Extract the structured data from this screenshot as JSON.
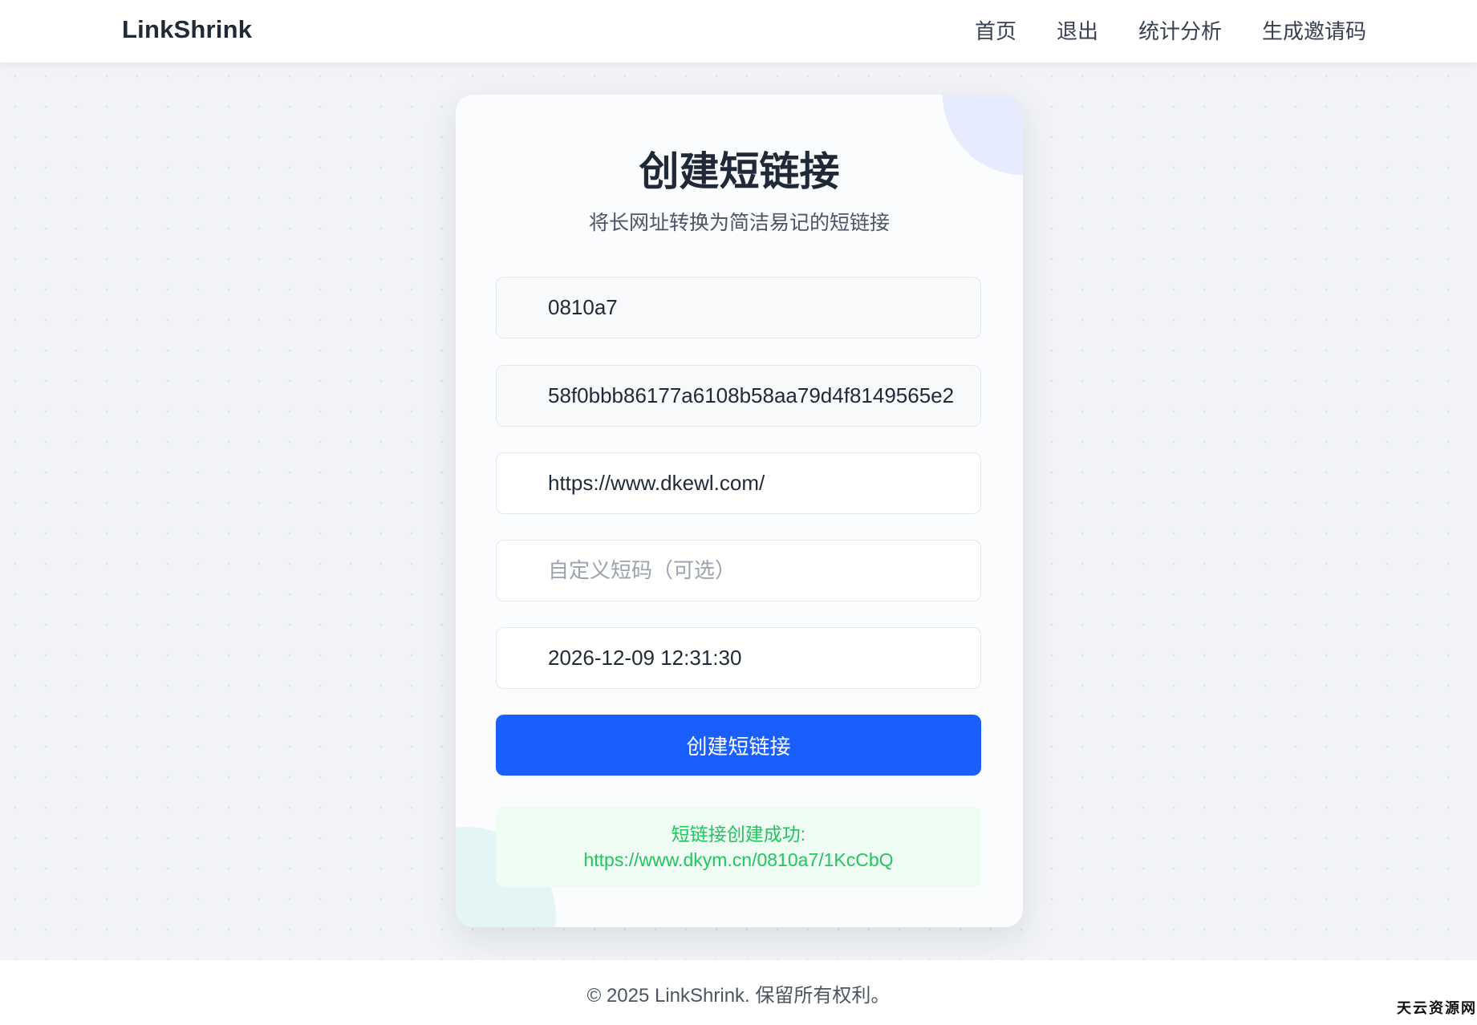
{
  "header": {
    "brand": "LinkShrink",
    "nav": {
      "home": "首页",
      "logout": "退出",
      "stats": "统计分析",
      "invite": "生成邀请码"
    }
  },
  "card": {
    "title": "创建短链接",
    "subtitle": "将长网址转换为简洁易记的短链接",
    "fields": {
      "user_id": "0810a7",
      "token": "58f0bbb86177a6108b58aa79d4f8149565e2",
      "long_url": "https://www.dkewl.com/",
      "custom_code_placeholder": "自定义短码（可选）",
      "expire_time": "2026-12-09 12:31:30"
    },
    "submit_label": "创建短链接",
    "result": {
      "message": "短链接创建成功:",
      "short_url": "https://www.dkym.cn/0810a7/1KcCbQ"
    }
  },
  "footer": {
    "copyright": "© 2025 LinkShrink. 保留所有权利。",
    "watermark": "天云资源网"
  },
  "colors": {
    "primary": "#1a5ffe",
    "success": "#22c55e",
    "success_bg": "#effcf3",
    "page_bg": "#f1f3f6"
  }
}
